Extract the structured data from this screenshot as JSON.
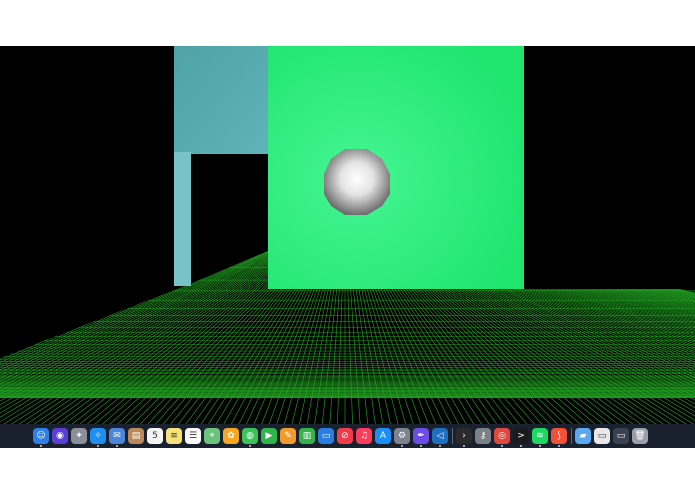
{
  "scene": {
    "background_color": "#000000",
    "wall_color": "#25f07b",
    "side_wall_color": "#53a7ad",
    "floor_grid_color": "#22aa22",
    "sphere_color": "#ffffff"
  },
  "dock": {
    "background_color": "#18212d",
    "items": [
      {
        "icon": "finder-icon",
        "color": "#2f7fe8",
        "glyph": "☺",
        "running": true
      },
      {
        "icon": "siri-icon",
        "color": "#5a3fd4",
        "glyph": "◉",
        "running": false
      },
      {
        "icon": "launchpad-icon",
        "color": "#8a8f9a",
        "glyph": "✦",
        "running": false
      },
      {
        "icon": "safari-icon",
        "color": "#1e8ef0",
        "glyph": "✧",
        "running": true
      },
      {
        "icon": "mail-icon",
        "color": "#4b86d8",
        "glyph": "✉",
        "running": true
      },
      {
        "icon": "contacts-icon",
        "color": "#b8895a",
        "glyph": "▤",
        "running": false
      },
      {
        "icon": "calendar-icon",
        "color": "#f4f4f4",
        "glyph": "5",
        "running": false
      },
      {
        "icon": "notes-icon",
        "color": "#f7e27a",
        "glyph": "≡",
        "running": false
      },
      {
        "icon": "reminders-icon",
        "color": "#fafafa",
        "glyph": "☰",
        "running": false
      },
      {
        "icon": "maps-icon",
        "color": "#6bc27a",
        "glyph": "⌖",
        "running": false
      },
      {
        "icon": "photos-icon",
        "color": "#f5a623",
        "glyph": "✿",
        "running": false
      },
      {
        "icon": "messages-icon",
        "color": "#3bc35a",
        "glyph": "◍",
        "running": true
      },
      {
        "icon": "facetime-icon",
        "color": "#2fb54a",
        "glyph": "▶",
        "running": false
      },
      {
        "icon": "pages-icon",
        "color": "#f19b2c",
        "glyph": "✎",
        "running": false
      },
      {
        "icon": "numbers-icon",
        "color": "#33b34a",
        "glyph": "▥",
        "running": false
      },
      {
        "icon": "keynote-icon",
        "color": "#2a7de1",
        "glyph": "▭",
        "running": false
      },
      {
        "icon": "news-icon",
        "color": "#f03b4b",
        "glyph": "⊘",
        "running": false
      },
      {
        "icon": "music-icon",
        "color": "#fa3d5a",
        "glyph": "♫",
        "running": false
      },
      {
        "icon": "app-store-icon",
        "color": "#1c8ef5",
        "glyph": "A",
        "running": false
      },
      {
        "icon": "system-preferences-icon",
        "color": "#7d848f",
        "glyph": "⚙",
        "running": true
      },
      {
        "icon": "pen-app-icon",
        "color": "#6b4de6",
        "glyph": "✒",
        "running": true
      },
      {
        "icon": "vscode-icon",
        "color": "#1e6fc0",
        "glyph": "◁",
        "running": true
      },
      {
        "icon": "terminal-icon",
        "color": "#2b2b2b",
        "glyph": "›",
        "running": true
      },
      {
        "icon": "keychain-icon",
        "color": "#7a7f88",
        "glyph": "⚷",
        "running": false
      },
      {
        "icon": "chrome-icon",
        "color": "#e0483e",
        "glyph": "◎",
        "running": true
      },
      {
        "icon": "terminal-2-icon",
        "color": "#1a1a1a",
        "glyph": ">",
        "running": true
      },
      {
        "icon": "spotify-icon",
        "color": "#1ed760",
        "glyph": "≋",
        "running": true
      },
      {
        "icon": "swift-icon",
        "color": "#f05138",
        "glyph": "⟆",
        "running": true
      },
      {
        "icon": "folder-icon",
        "color": "#5aa9ee",
        "glyph": "▰",
        "running": false
      },
      {
        "icon": "downloads-stack-icon",
        "color": "#e8e8e8",
        "glyph": "▭",
        "running": false
      },
      {
        "icon": "document-stack-icon",
        "color": "#3a4250",
        "glyph": "▭",
        "running": false
      },
      {
        "icon": "trash-icon",
        "color": "#9aa0a8",
        "glyph": "🗑",
        "running": false
      }
    ]
  }
}
